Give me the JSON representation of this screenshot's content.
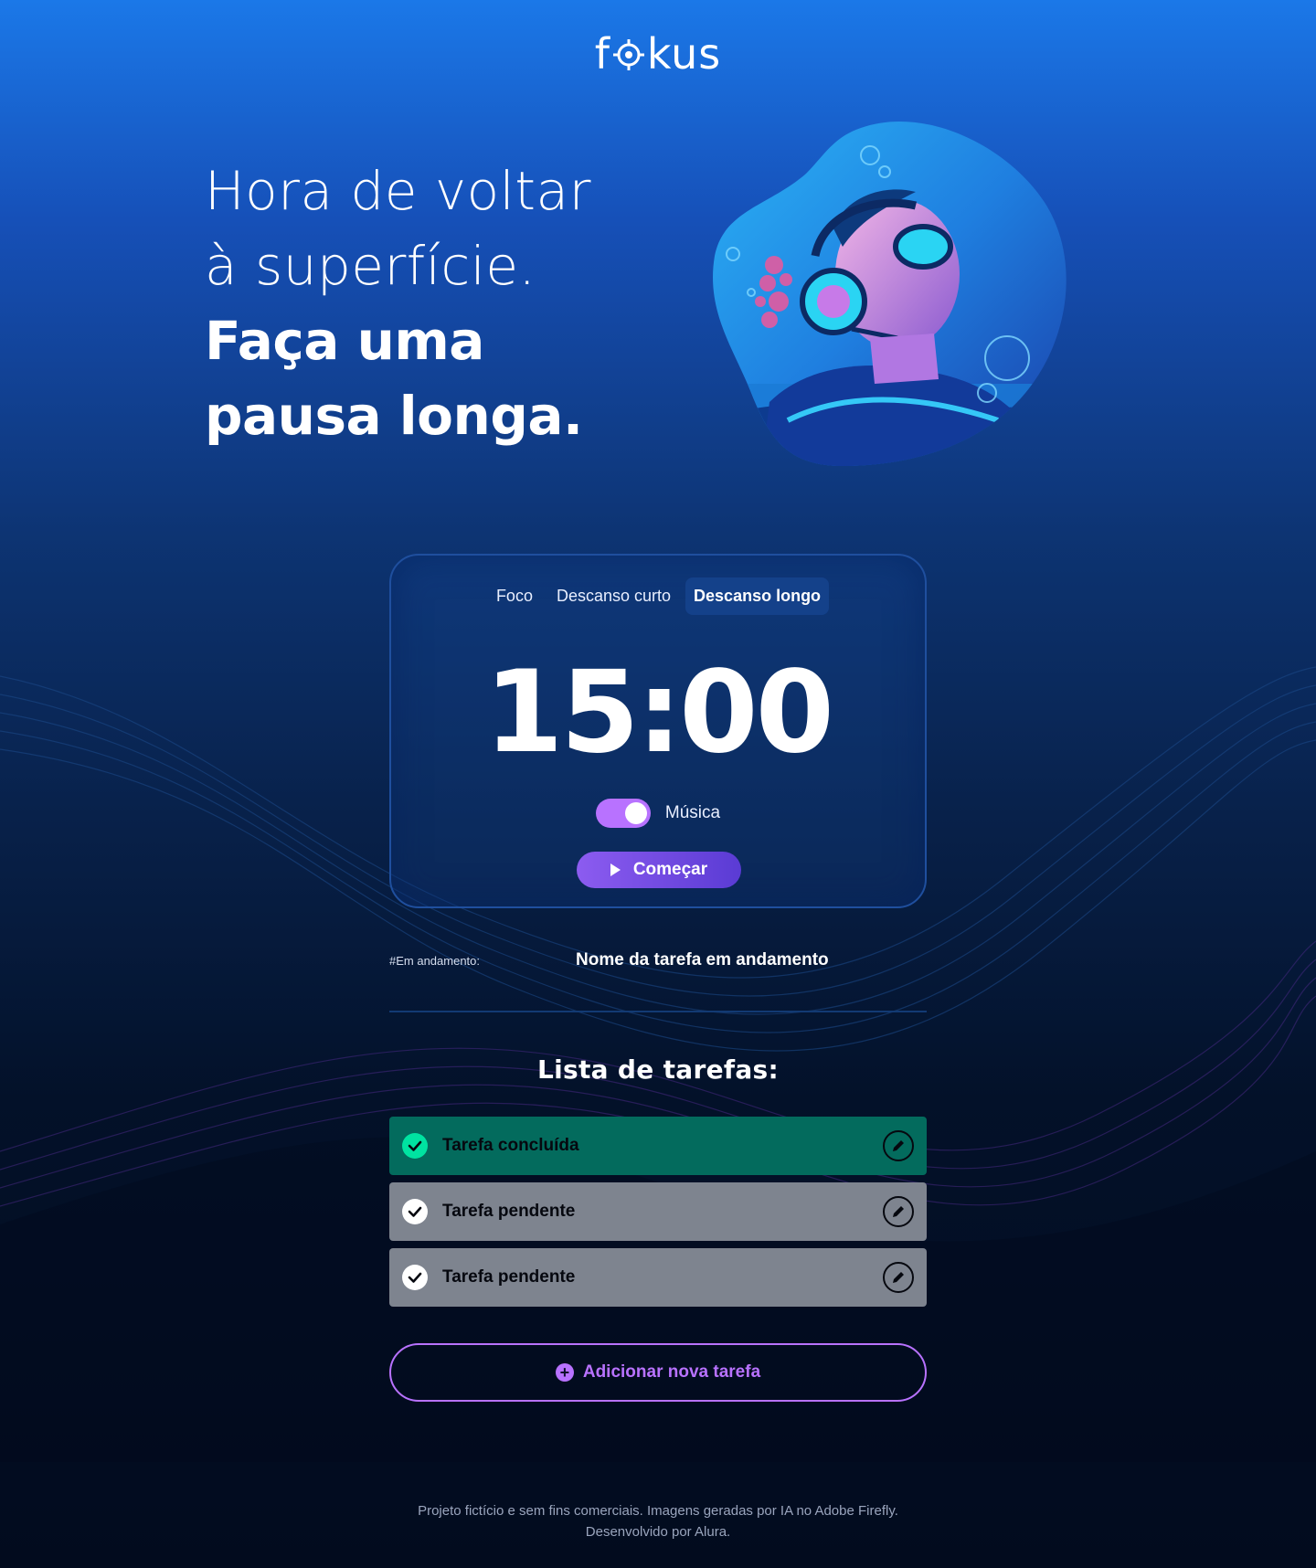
{
  "header": {
    "logo_pre": "f",
    "logo_post": "kus"
  },
  "hero": {
    "line1": "Hora de voltar",
    "line2": "à superfície.",
    "line3": "Faça uma",
    "line4": "pausa longa.",
    "image_icon": "diver-headphones-illustration"
  },
  "timer": {
    "tabs": [
      "Foco",
      "Descanso curto",
      "Descanso longo"
    ],
    "active_tab": "Descanso longo",
    "time": "15:00",
    "music_label": "Música",
    "music_on": true,
    "start_label": "Começar"
  },
  "progress": {
    "label": "#Em andamento:",
    "task": "Nome da tarefa em andamento"
  },
  "tasks": {
    "title": "Lista de tarefas:",
    "items": [
      {
        "label": "Tarefa concluída",
        "status": "done"
      },
      {
        "label": "Tarefa pendente",
        "status": "pending"
      },
      {
        "label": "Tarefa pendente",
        "status": "pending"
      }
    ],
    "add_label": "Adicionar nova tarefa"
  },
  "footer": {
    "line1": "Projeto fictício e sem fins comerciais. Imagens geradas por IA no Adobe Firefly.",
    "line2": "Desenvolvido por Alura."
  },
  "colors": {
    "accent": "#b872ff",
    "done": "#036b5d",
    "pending": "#7e848f",
    "check_done": "#00e3a1"
  }
}
